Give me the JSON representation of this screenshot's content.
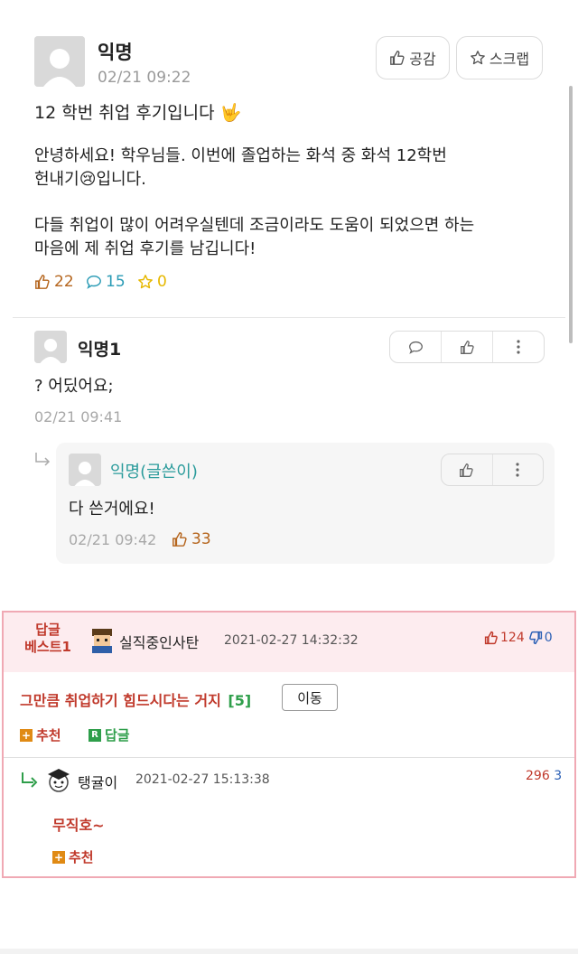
{
  "post": {
    "author": "익명",
    "date": "02/21 09:22",
    "empathy_label": "공감",
    "scrap_label": "스크랩",
    "title": "12 학번 취업 후기입니다 🤟",
    "body_1a": "안녕하세요! 학우님들. 이번에 졸업하는 화석 중 화석 12학번",
    "body_1b_pre": "헌내기",
    "body_1b_emoji": "😢",
    "body_1b_post": "입니다.",
    "body_2a": "다들 취업이 많이 어려우실텐데 조금이라도 도움이 되었으면 하는",
    "body_2b": "마음에 제 취업 후기를 남깁니다!",
    "likes": "22",
    "comments": "15",
    "scraps": "0"
  },
  "comment1": {
    "author": "익명1",
    "text": "? 어딨어요;",
    "date": "02/21 09:41"
  },
  "reply1": {
    "author": "익명(글쓴이)",
    "text": "다 쓴거에요!",
    "date": "02/21 09:42",
    "likes": "33"
  },
  "best": {
    "badge_line1": "답글",
    "badge_line2": "베스트1",
    "author": "실직중인사탄",
    "datetime": "2021-02-27 14:32:32",
    "up": "124",
    "down": "0",
    "text": "그만큼 취업하기 힘드시다는 거지",
    "reply_count": "[5]",
    "move_label": "이동",
    "recommend_label": "추천",
    "reply_label": "답글",
    "sub": {
      "author": "탱귤이",
      "datetime": "2021-02-27 15:13:38",
      "num1": "296",
      "num2": "3",
      "text": "무직호~",
      "recommend_label": "추천"
    }
  },
  "colors": {
    "like": "#b5651d",
    "comment": "#2a9bb5",
    "scrap": "#e6b800",
    "author_teal": "#2a9b9b",
    "best_red": "#c0392b",
    "best_pink_bg": "#fdecef",
    "best_border": "#f0a9b4",
    "green": "#2e9e4a",
    "orange": "#e08a14"
  }
}
